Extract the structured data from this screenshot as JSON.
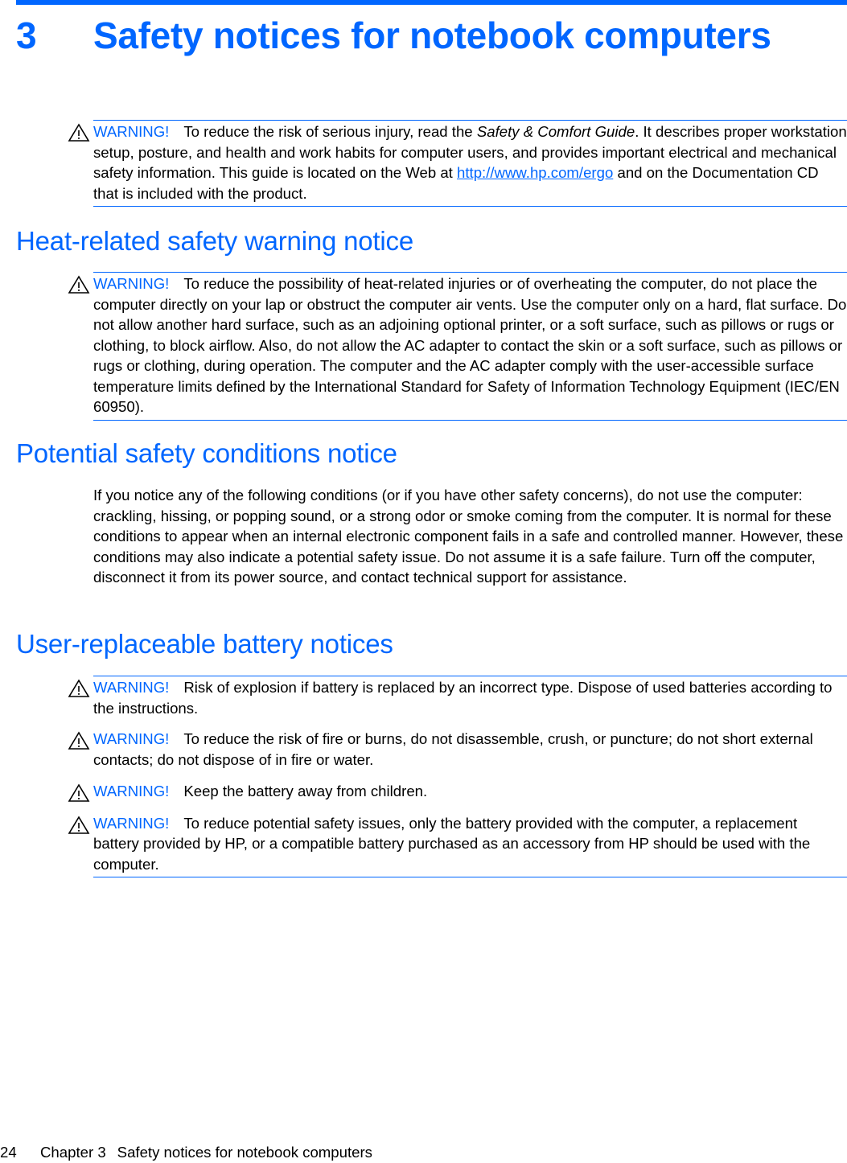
{
  "document": {
    "accent_color": "#0066ff",
    "chapter": {
      "number": "3",
      "title": "Safety notices for notebook computers"
    },
    "intro_warning": {
      "label": "WARNING!",
      "text_before_italic": "To reduce the risk of serious injury, read the ",
      "italic": "Safety & Comfort Guide",
      "text_after_italic": ". It describes proper workstation setup, posture, and health and work habits for computer users, and provides important electrical and mechanical safety information. This guide is located on the Web at ",
      "link": "http://www.hp.com/ergo",
      "text_after_link": " and on the Documentation CD that is included with the product."
    },
    "sections": [
      {
        "heading": "Heat-related safety warning notice",
        "warnings": [
          {
            "label": "WARNING!",
            "text": "To reduce the possibility of heat-related injuries or of overheating the computer, do not place the computer directly on your lap or obstruct the computer air vents. Use the computer only on a hard, flat surface. Do not allow another hard surface, such as an adjoining optional printer, or a soft surface, such as pillows or rugs or clothing, to block airflow. Also, do not allow the AC adapter to contact the skin or a soft surface, such as pillows or rugs or clothing, during operation. The computer and the AC adapter comply with the user-accessible surface temperature limits defined by the International Standard for Safety of Information Technology Equipment (IEC/EN 60950)."
          }
        ]
      },
      {
        "heading": "Potential safety conditions notice",
        "paragraph": "If you notice any of the following conditions (or if you have other safety concerns), do not use the computer: crackling, hissing, or popping sound, or a strong odor or smoke coming from the computer. It is normal for these conditions to appear when an internal electronic component fails in a safe and controlled manner. However, these conditions may also indicate a potential safety issue. Do not assume it is a safe failure. Turn off the computer, disconnect it from its power source, and contact technical support for assistance."
      },
      {
        "heading": "User-replaceable battery notices",
        "warnings": [
          {
            "label": "WARNING!",
            "text": "Risk of explosion if battery is replaced by an incorrect type. Dispose of used batteries according to the instructions."
          },
          {
            "label": "WARNING!",
            "text": "To reduce the risk of fire or burns, do not disassemble, crush, or puncture; do not short external contacts; do not dispose of in fire or water."
          },
          {
            "label": "WARNING!",
            "text": "Keep the battery away from children."
          },
          {
            "label": "WARNING!",
            "text": "To reduce potential safety issues, only the battery provided with the computer, a replacement battery provided by HP, or a compatible battery purchased as an accessory from HP should be used with the computer."
          }
        ]
      }
    ],
    "footer": {
      "page_number": "24",
      "chapter_label": "Chapter 3",
      "chapter_title": "Safety notices for notebook computers"
    },
    "icons": {
      "warning": "warning-triangle-icon"
    }
  }
}
